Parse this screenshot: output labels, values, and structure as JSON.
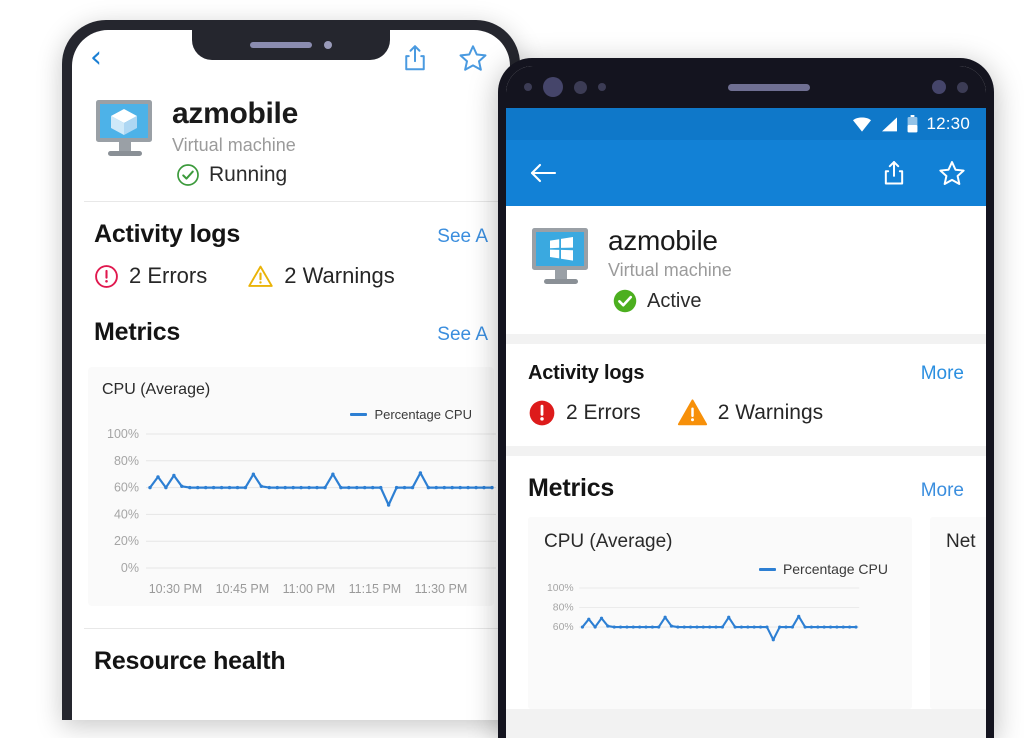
{
  "left_phone": {
    "device": "iphone-x",
    "navbar": {
      "back_icon": "chevron-left-icon",
      "share_icon": "share-icon",
      "favorite_icon": "star-icon"
    },
    "resource": {
      "icon": "azure-virtual-machine-icon",
      "name": "azmobile",
      "type": "Virtual machine",
      "status": "Running",
      "status_icon": "check-circle-outline-icon",
      "status_color": "#3c9a3c"
    },
    "sections": [
      {
        "title": "Activity logs",
        "link": "See A",
        "badges": [
          {
            "icon": "error-circle-icon",
            "label": "2 Errors",
            "color": "#e0184e"
          },
          {
            "icon": "warning-triangle-icon",
            "label": "2 Warnings",
            "color": "#eab308"
          }
        ]
      },
      {
        "title": "Metrics",
        "link": "See A"
      }
    ],
    "resource_health_title": "Resource health"
  },
  "right_phone": {
    "device": "android",
    "status_bar": {
      "wifi_icon": "wifi-icon",
      "signal_icon": "cellular-signal-icon",
      "battery_icon": "battery-icon",
      "clock": "12:30"
    },
    "appbar": {
      "back_icon": "arrow-left-icon",
      "share_icon": "share-icon",
      "favorite_icon": "star-icon",
      "background": "#1281d6"
    },
    "resource": {
      "icon": "windows-virtual-machine-icon",
      "name": "azmobile",
      "type": "Virtual machine",
      "status": "Active",
      "status_icon": "check-circle-filled-icon",
      "status_color": "#4caf1f"
    },
    "sections": [
      {
        "title": "Activity logs",
        "link": "More",
        "badges": [
          {
            "icon": "error-circle-filled-icon",
            "label": "2 Errors",
            "color": "#dd1b1b"
          },
          {
            "icon": "warning-triangle-filled-icon",
            "label": "2 Warnings",
            "color": "#f79009"
          }
        ]
      },
      {
        "title": "Metrics",
        "link": "More"
      }
    ],
    "side_chart_title": "Net"
  },
  "chart_data": {
    "type": "line",
    "title": "CPU (Average)",
    "legend": [
      {
        "name": "Percentage CPU",
        "color": "#2d7fd3"
      }
    ],
    "legend_position": "top-right",
    "xlabel": "",
    "ylabel": "",
    "ylim": [
      0,
      100
    ],
    "yticks": [
      "0%",
      "20%",
      "40%",
      "60%",
      "80%",
      "100%"
    ],
    "ytick_values": [
      0,
      20,
      40,
      60,
      80,
      100
    ],
    "xticks": [
      "10:30 PM",
      "10:45 PM",
      "11:00 PM",
      "11:15 PM",
      "11:30 PM"
    ],
    "grid": true,
    "series": [
      {
        "name": "Percentage CPU",
        "color": "#2d7fd3",
        "values": [
          60,
          68,
          60,
          69,
          61,
          60,
          60,
          60,
          60,
          60,
          60,
          60,
          60,
          70,
          61,
          60,
          60,
          60,
          60,
          60,
          60,
          60,
          60,
          70,
          60,
          60,
          60,
          60,
          60,
          60,
          47,
          60,
          60,
          60,
          71,
          60,
          60,
          60,
          60,
          60,
          60,
          60,
          60,
          60
        ]
      }
    ],
    "side_chart": {
      "type": "line",
      "title": "Net",
      "yticks": [
        "100%",
        "80%",
        "60%"
      ]
    }
  }
}
